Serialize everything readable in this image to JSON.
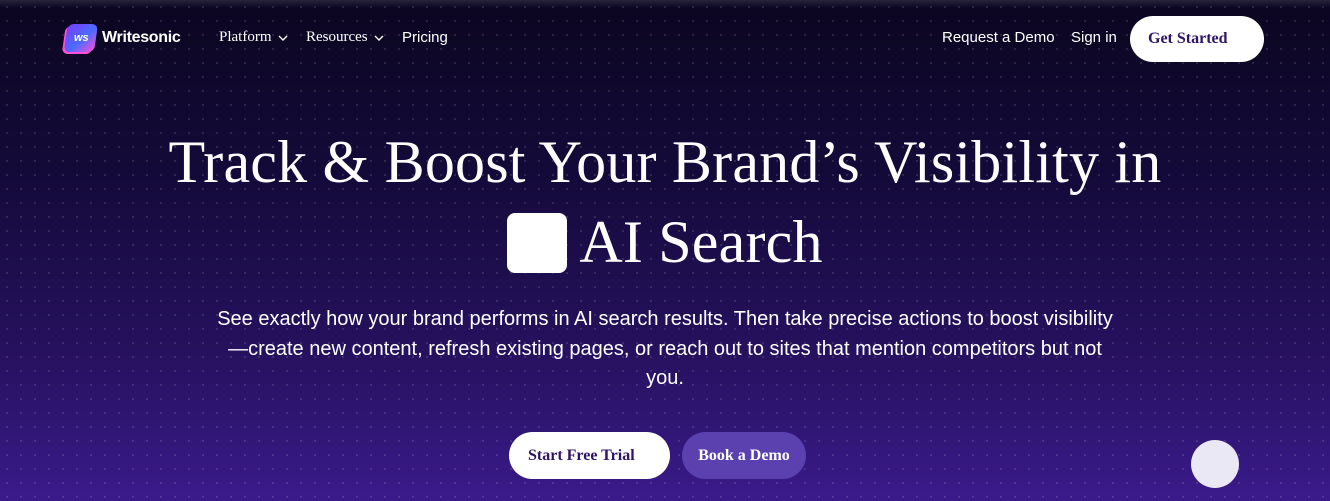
{
  "nav": {
    "brand": "Writesonic",
    "logo_mark_text": "ws",
    "items": [
      {
        "label": "Platform",
        "has_dropdown": true
      },
      {
        "label": "Resources",
        "has_dropdown": true
      },
      {
        "label": "Pricing",
        "has_dropdown": false
      }
    ],
    "request_demo_label": "Request a Demo",
    "sign_in_label": "Sign in",
    "get_started_label": "Get Started"
  },
  "hero": {
    "title_line1": "Track & Boost Your Brand’s Visibility in",
    "title_line2": "AI Search",
    "subtitle": "See exactly how your brand performs in AI search results. Then take precise actions to boost visibility—create new content, refresh existing pages, or reach out to sites that mention competitors but not you.",
    "primary_cta_label": "Start Free Trial",
    "secondary_cta_label": "Book a Demo"
  },
  "icons": {
    "dropdown": "chevron-down-icon",
    "chat": "chat-widget-icon"
  },
  "colors": {
    "background_top": "#0b0620",
    "background_bottom": "#3a1a8a",
    "button_text": "#2d1466",
    "secondary_button": "#5b40b0"
  }
}
